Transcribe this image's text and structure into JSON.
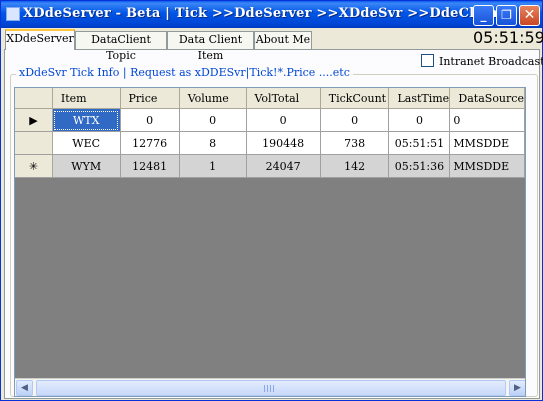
{
  "window": {
    "title": "XDdeServer - Beta | Tick >>DdeServer >>XDdeSvr >>DdeClient",
    "controls": {
      "minimize": "_",
      "maximize": "❐",
      "close": "✕"
    }
  },
  "tabs": [
    {
      "label": "XDdeServer",
      "active": true
    },
    {
      "label": "DataClient Topic",
      "active": false
    },
    {
      "label": "Data Client Item",
      "active": false
    },
    {
      "label": "About Me",
      "active": false
    }
  ],
  "clock": "05:51:59",
  "intranet": {
    "label": "Intranet Broadcast",
    "checked": false
  },
  "group": {
    "label": "xDdeSvr Tick Info | Request as xDDESvr|Tick!*.Price ....etc"
  },
  "grid": {
    "columns": [
      "Item",
      "Price",
      "Volume",
      "VolTotal",
      "TickCount",
      "LastTime",
      "DataSource"
    ],
    "rows": [
      {
        "marker": "▶",
        "cells": [
          "WTX",
          "0",
          "0",
          "0",
          "0",
          "0",
          "0"
        ]
      },
      {
        "marker": "",
        "cells": [
          "WEC",
          "12776",
          "8",
          "190448",
          "738",
          "05:51:51",
          "MMSDDE"
        ]
      },
      {
        "marker": "✳",
        "cells": [
          "WYM",
          "12481",
          "1",
          "24047",
          "142",
          "05:51:36",
          "MMSDDE"
        ]
      }
    ]
  },
  "scrollbar": {
    "left_arrow": "◀",
    "right_arrow": "▶"
  }
}
